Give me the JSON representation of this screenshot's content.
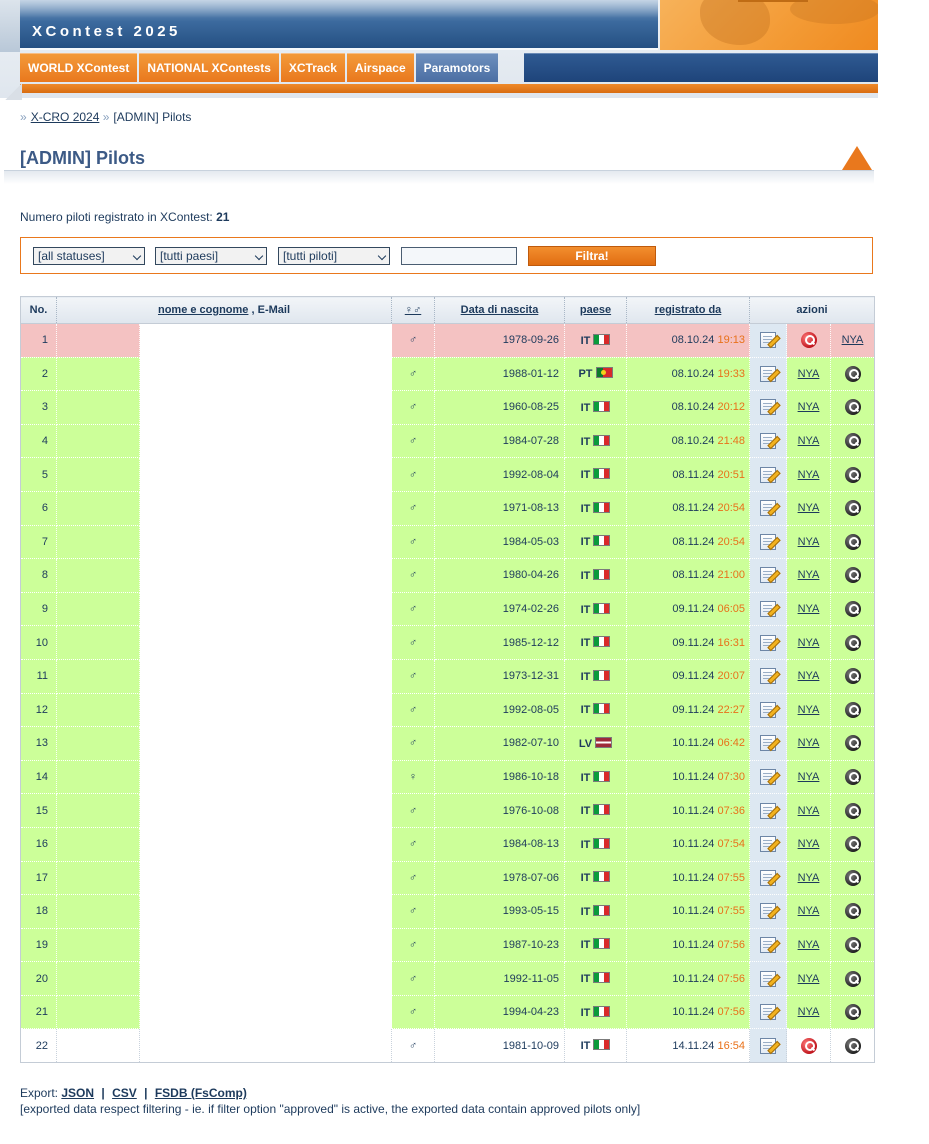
{
  "header": {
    "site_title": "XContest 2025",
    "nav": [
      {
        "label": "WORLD XContest",
        "style": "orange"
      },
      {
        "label": "NATIONAL XContests",
        "style": "orange"
      },
      {
        "label": "XCTrack",
        "style": "orange"
      },
      {
        "label": "Airspace",
        "style": "orange"
      },
      {
        "label": "Paramotors",
        "style": "blue"
      }
    ]
  },
  "breadcrumb": {
    "parent": "X-CRO 2024",
    "current": "[ADMIN] Pilots"
  },
  "page_title": "[ADMIN] Pilots",
  "count": {
    "label": "Numero piloti registrato in XContest:",
    "value": "21"
  },
  "filter": {
    "status": "[all statuses]",
    "country": "[tutti paesi]",
    "pilots": "[tutti piloti]",
    "text_value": "",
    "button": "Filtra!"
  },
  "table": {
    "headers": {
      "no": "No.",
      "name": "nome e cognome",
      "email_sep": ",",
      "email": "E-Mail",
      "sex": "♀♂",
      "birth": "Data di nascita",
      "country": "paese",
      "registered": "registrato da",
      "actions": "azioni"
    },
    "rows": [
      {
        "no": "1",
        "sex": "♂",
        "birth": "1978-09-26",
        "cc": "IT",
        "flag": "it",
        "date": "08.10.24",
        "time": "19:13",
        "state": "pink",
        "col2": "red-mag",
        "col3": "NYA"
      },
      {
        "no": "2",
        "sex": "♂",
        "birth": "1988-01-12",
        "cc": "PT",
        "flag": "pt",
        "date": "08.10.24",
        "time": "19:33",
        "state": "green",
        "col2": "NYA",
        "col3": "dark-mag"
      },
      {
        "no": "3",
        "sex": "♂",
        "birth": "1960-08-25",
        "cc": "IT",
        "flag": "it",
        "date": "08.10.24",
        "time": "20:12",
        "state": "green",
        "col2": "NYA",
        "col3": "dark-mag"
      },
      {
        "no": "4",
        "sex": "♂",
        "birth": "1984-07-28",
        "cc": "IT",
        "flag": "it",
        "date": "08.10.24",
        "time": "21:48",
        "state": "green",
        "col2": "NYA",
        "col3": "dark-mag"
      },
      {
        "no": "5",
        "sex": "♂",
        "birth": "1992-08-04",
        "cc": "IT",
        "flag": "it",
        "date": "08.11.24",
        "time": "20:51",
        "state": "green",
        "col2": "NYA",
        "col3": "dark-mag"
      },
      {
        "no": "6",
        "sex": "♂",
        "birth": "1971-08-13",
        "cc": "IT",
        "flag": "it",
        "date": "08.11.24",
        "time": "20:54",
        "state": "green",
        "col2": "NYA",
        "col3": "dark-mag"
      },
      {
        "no": "7",
        "sex": "♂",
        "birth": "1984-05-03",
        "cc": "IT",
        "flag": "it",
        "date": "08.11.24",
        "time": "20:54",
        "state": "green",
        "col2": "NYA",
        "col3": "dark-mag"
      },
      {
        "no": "8",
        "sex": "♂",
        "birth": "1980-04-26",
        "cc": "IT",
        "flag": "it",
        "date": "08.11.24",
        "time": "21:00",
        "state": "green",
        "col2": "NYA",
        "col3": "dark-mag"
      },
      {
        "no": "9",
        "sex": "♂",
        "birth": "1974-02-26",
        "cc": "IT",
        "flag": "it",
        "date": "09.11.24",
        "time": "06:05",
        "state": "green",
        "col2": "NYA",
        "col3": "dark-mag"
      },
      {
        "no": "10",
        "sex": "♂",
        "birth": "1985-12-12",
        "cc": "IT",
        "flag": "it",
        "date": "09.11.24",
        "time": "16:31",
        "state": "green",
        "col2": "NYA",
        "col3": "dark-mag"
      },
      {
        "no": "11",
        "sex": "♂",
        "birth": "1973-12-31",
        "cc": "IT",
        "flag": "it",
        "date": "09.11.24",
        "time": "20:07",
        "state": "green",
        "col2": "NYA",
        "col3": "dark-mag"
      },
      {
        "no": "12",
        "sex": "♂",
        "birth": "1992-08-05",
        "cc": "IT",
        "flag": "it",
        "date": "09.11.24",
        "time": "22:27",
        "state": "green",
        "col2": "NYA",
        "col3": "dark-mag"
      },
      {
        "no": "13",
        "sex": "♂",
        "birth": "1982-07-10",
        "cc": "LV",
        "flag": "lv",
        "date": "10.11.24",
        "time": "06:42",
        "state": "green",
        "col2": "NYA",
        "col3": "dark-mag"
      },
      {
        "no": "14",
        "sex": "♀",
        "birth": "1986-10-18",
        "cc": "IT",
        "flag": "it",
        "date": "10.11.24",
        "time": "07:30",
        "state": "green",
        "col2": "NYA",
        "col3": "dark-mag"
      },
      {
        "no": "15",
        "sex": "♂",
        "birth": "1976-10-08",
        "cc": "IT",
        "flag": "it",
        "date": "10.11.24",
        "time": "07:36",
        "state": "green",
        "col2": "NYA",
        "col3": "dark-mag"
      },
      {
        "no": "16",
        "sex": "♂",
        "birth": "1984-08-13",
        "cc": "IT",
        "flag": "it",
        "date": "10.11.24",
        "time": "07:54",
        "state": "green",
        "col2": "NYA",
        "col3": "dark-mag"
      },
      {
        "no": "17",
        "sex": "♂",
        "birth": "1978-07-06",
        "cc": "IT",
        "flag": "it",
        "date": "10.11.24",
        "time": "07:55",
        "state": "green",
        "col2": "NYA",
        "col3": "dark-mag"
      },
      {
        "no": "18",
        "sex": "♂",
        "birth": "1993-05-15",
        "cc": "IT",
        "flag": "it",
        "date": "10.11.24",
        "time": "07:55",
        "state": "green",
        "col2": "NYA",
        "col3": "dark-mag"
      },
      {
        "no": "19",
        "sex": "♂",
        "birth": "1987-10-23",
        "cc": "IT",
        "flag": "it",
        "date": "10.11.24",
        "time": "07:56",
        "state": "green",
        "col2": "NYA",
        "col3": "dark-mag"
      },
      {
        "no": "20",
        "sex": "♂",
        "birth": "1992-11-05",
        "cc": "IT",
        "flag": "it",
        "date": "10.11.24",
        "time": "07:56",
        "state": "green",
        "col2": "NYA",
        "col3": "dark-mag"
      },
      {
        "no": "21",
        "sex": "♂",
        "birth": "1994-04-23",
        "cc": "IT",
        "flag": "it",
        "date": "10.11.24",
        "time": "07:56",
        "state": "green",
        "col2": "NYA",
        "col3": "dark-mag"
      },
      {
        "no": "22",
        "sex": "♂",
        "birth": "1981-10-09",
        "cc": "IT",
        "flag": "it",
        "date": "14.11.24",
        "time": "16:54",
        "state": "white",
        "col2": "red-mag",
        "col3": "dark-mag"
      }
    ]
  },
  "export": {
    "label": "Export:",
    "json": "JSON",
    "csv": "CSV",
    "fsdb": "FSDB (FsComp)",
    "separator": "|",
    "note": "[exported data respect filtering - ie. if filter option \"approved\" is active, the exported data contain approved pilots only]"
  },
  "colors": {
    "approved_row": "#ccff99",
    "pending_row": "#f4c2c2",
    "accent_orange": "#e9781d",
    "nav_blue": "#1e447a",
    "time_orange": "#e8711a"
  }
}
